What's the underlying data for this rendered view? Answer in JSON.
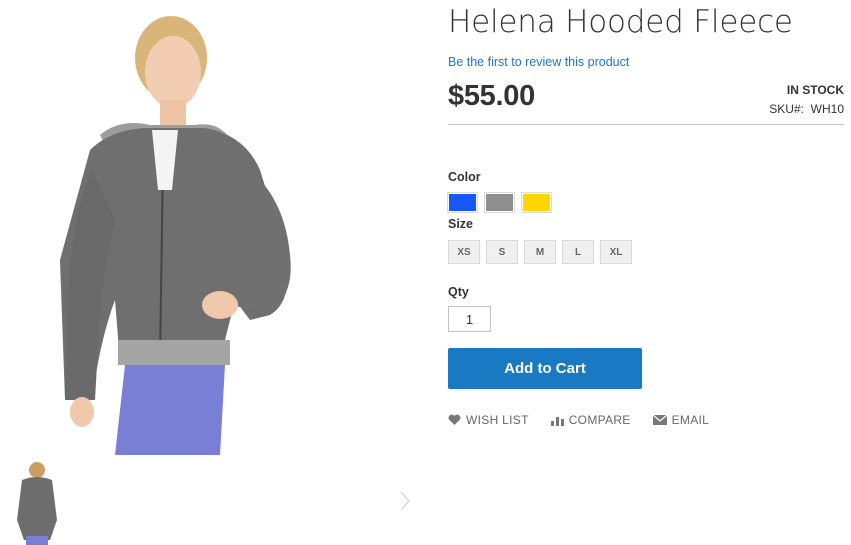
{
  "product": {
    "title": "Helena Hooded Fleece",
    "review_link": "Be the first to review this product",
    "price": "$55.00",
    "stock": "IN STOCK",
    "sku_label": "SKU#:",
    "sku_value": "WH10"
  },
  "options": {
    "color_label": "Color",
    "colors": [
      {
        "name": "Blue",
        "hex": "#1857f7"
      },
      {
        "name": "Gray",
        "hex": "#8f8f8f"
      },
      {
        "name": "Yellow",
        "hex": "#ffd500"
      }
    ],
    "size_label": "Size",
    "sizes": [
      "XS",
      "S",
      "M",
      "L",
      "XL"
    ]
  },
  "qty": {
    "label": "Qty",
    "value": "1"
  },
  "add_to_cart": "Add to Cart",
  "actions": {
    "wishlist": "WISH LIST",
    "compare": "COMPARE",
    "email": "EMAIL"
  },
  "colors": {
    "accent": "#1979c3",
    "link": "#1979c3",
    "text": "#333333",
    "muted": "#666666"
  }
}
